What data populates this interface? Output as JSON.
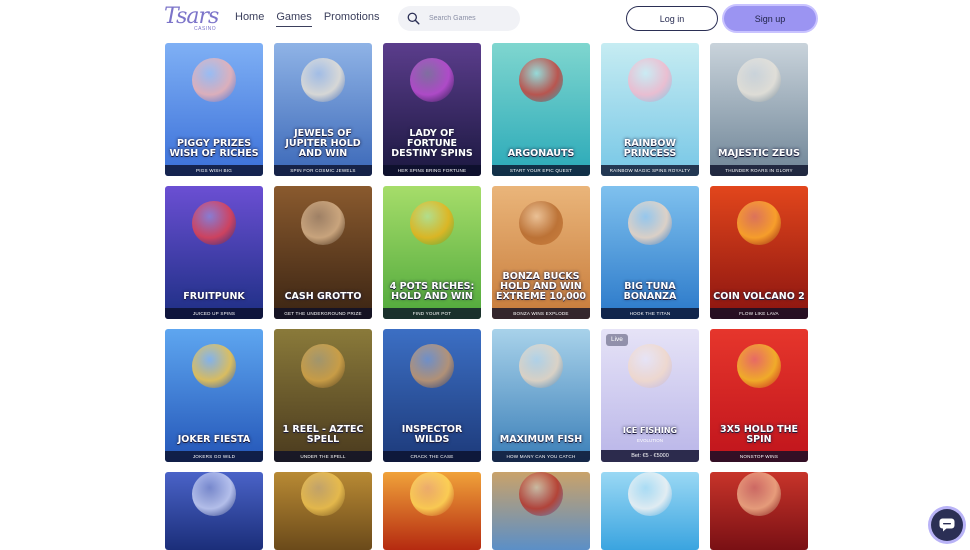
{
  "header": {
    "logo": "Tsars",
    "logo_sub": "CASINO",
    "nav": [
      {
        "label": "Home",
        "active": false
      },
      {
        "label": "Games",
        "active": true
      },
      {
        "label": "Promotions",
        "active": false
      }
    ],
    "search_placeholder": "Search Games",
    "login_label": "Log in",
    "signup_label": "Sign up"
  },
  "games": [
    {
      "title": "Piggy Prizes Wish of Riches",
      "tag": "PIGS WISH BIG",
      "bg": [
        "#3a6fd8",
        "#7fb0f5"
      ],
      "accent": "#f0b3b3"
    },
    {
      "title": "Jewels of Jupiter Hold and Win",
      "tag": "SPIN FOR COSMIC JEWELS",
      "bg": [
        "#3b68b8",
        "#8fb3e6"
      ],
      "accent": "#e8e2d6"
    },
    {
      "title": "Lady of Fortune Destiny Spins",
      "tag": "HER SPINS BRING FORTUNE",
      "bg": [
        "#1b1840",
        "#5b3d8c"
      ],
      "accent": "#c04fd6"
    },
    {
      "title": "Argonauts",
      "tag": "START YOUR EPIC QUEST",
      "bg": [
        "#2aa9b8",
        "#7fd6cf"
      ],
      "accent": "#c7413a"
    },
    {
      "title": "Rainbow Princess",
      "tag": "RAINBOW MAGIC SPINS ROYALTY",
      "bg": [
        "#77c7e6",
        "#c6ecf2"
      ],
      "accent": "#f4b8cc"
    },
    {
      "title": "Majestic Zeus",
      "tag": "THUNDER ROARS IN GLORY",
      "bg": [
        "#6f8597",
        "#c9d3db"
      ],
      "accent": "#e7e3da"
    },
    {
      "title": "Fruitpunk",
      "tag": "JUICED UP SPINS",
      "bg": [
        "#1d2f84",
        "#6b4fd3"
      ],
      "accent": "#e34250"
    },
    {
      "title": "Cash Grotto",
      "tag": "GET THE UNDERGROUND PRIZE",
      "bg": [
        "#3a2413",
        "#8a5a2e"
      ],
      "accent": "#d8b48c"
    },
    {
      "title": "4 Pots Riches: Hold and Win",
      "tag": "FIND YOUR POT",
      "bg": [
        "#4fa83b",
        "#a6dd6a"
      ],
      "accent": "#e9b21c"
    },
    {
      "title": "Bonza Bucks Hold and Win Extreme 10,000",
      "tag": "BONZA WINS EXPLODE",
      "bg": [
        "#c77b3a",
        "#eab57a"
      ],
      "accent": "#b66a2e"
    },
    {
      "title": "Big Tuna Bonanza",
      "tag": "HOOK THE TITAN",
      "bg": [
        "#2a78c9",
        "#7fc1ee"
      ],
      "accent": "#f0d7c2"
    },
    {
      "title": "Coin Volcano 2",
      "tag": "FLOW LIKE LAVA",
      "bg": [
        "#8a1410",
        "#e2461c"
      ],
      "accent": "#ffb02e"
    },
    {
      "title": "Joker Fiesta",
      "tag": "JOKERS GO WILD",
      "bg": [
        "#2456b8",
        "#5ea6f0"
      ],
      "accent": "#f2c54a"
    },
    {
      "title": "1 Reel - Aztec Spell",
      "tag": "UNDER THE SPELL",
      "bg": [
        "#4a3a1e",
        "#8a7a3a"
      ],
      "accent": "#d6a64a"
    },
    {
      "title": "Inspector Wilds",
      "tag": "CRACK THE CASE",
      "bg": [
        "#1d3a7a",
        "#3c6fc4"
      ],
      "accent": "#c79a6e"
    },
    {
      "title": "Maximum Fish",
      "tag": "HOW MANY CAN YOU CATCH",
      "bg": [
        "#3b7fb8",
        "#a8d2ea"
      ],
      "accent": "#e8d6c2"
    },
    {
      "title": "Ice Fishing",
      "tag": "",
      "bg": [
        "#b9b5e8",
        "#e6e3f7"
      ],
      "accent": "#f1d8c9",
      "live": "Live",
      "sub": "EVOLUTION",
      "ribbon": "Bet: €5 - €5000"
    },
    {
      "title": "3x5 Hold the Spin",
      "tag": "NONSTOP WINS",
      "bg": [
        "#c0141c",
        "#e6362c"
      ],
      "accent": "#f4c12a"
    },
    {
      "title": "",
      "tag": "",
      "bg": [
        "#1b2e7a",
        "#4a63c8"
      ],
      "accent": "#c9d2f5",
      "partial": true
    },
    {
      "title": "",
      "tag": "",
      "bg": [
        "#6b4a1a",
        "#b88a34"
      ],
      "accent": "#f0c452",
      "partial": true
    },
    {
      "title": "",
      "tag": "",
      "bg": [
        "#b52a10",
        "#f0a23a"
      ],
      "accent": "#ffd95a",
      "partial": true
    },
    {
      "title": "",
      "tag": "",
      "bg": [
        "#5b8fc7",
        "#c9a26a"
      ],
      "accent": "#b5342a",
      "partial": true
    },
    {
      "title": "",
      "tag": "",
      "bg": [
        "#3aa4e0",
        "#9ad8f4"
      ],
      "accent": "#f3f3f3",
      "partial": true
    },
    {
      "title": "",
      "tag": "",
      "bg": [
        "#7a1014",
        "#c8342a"
      ],
      "accent": "#f0b08a",
      "partial": true
    }
  ],
  "chat_icon": "chat-icon"
}
